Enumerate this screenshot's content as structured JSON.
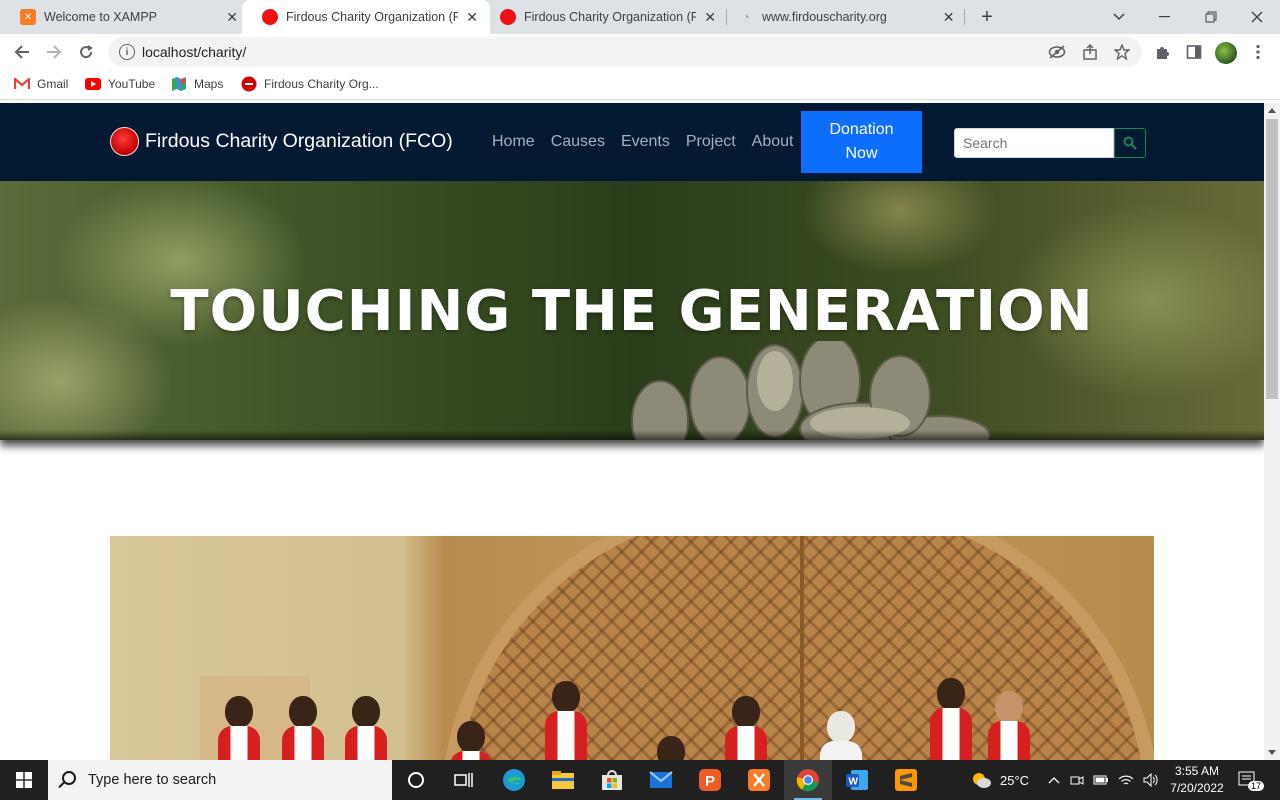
{
  "browser": {
    "tabs": [
      {
        "title": "Welcome to XAMPP",
        "active": false
      },
      {
        "title": "Firdous Charity Organization (FCO)",
        "active": true
      },
      {
        "title": "Firdous Charity Organization (FCO)",
        "active": false
      },
      {
        "title": "www.firdouscharity.org",
        "active": false
      }
    ],
    "url": "localhost/charity/",
    "bookmarks": [
      {
        "label": "Gmail",
        "icon": "gmail-icon"
      },
      {
        "label": "YouTube",
        "icon": "youtube-icon"
      },
      {
        "label": "Maps",
        "icon": "maps-icon"
      },
      {
        "label": "Firdous Charity Org...",
        "icon": "fco-favicon"
      }
    ]
  },
  "site": {
    "brand": "Firdous Charity Organization (FCO)",
    "nav": [
      "Home",
      "Causes",
      "Events",
      "Project",
      "About"
    ],
    "donate_line1": "Donation",
    "donate_line2": "Now",
    "search_placeholder": "Search",
    "hero_title": "TOUCHING THE GENERATION"
  },
  "taskbar": {
    "search_placeholder": "Type here to search",
    "weather": "25°C",
    "time": "3:55 AM",
    "date": "7/20/2022",
    "notifications": "17"
  },
  "colors": {
    "site_nav_bg": "#041a33",
    "donate_bg": "#0d6efd",
    "search_btn": "#198754"
  }
}
